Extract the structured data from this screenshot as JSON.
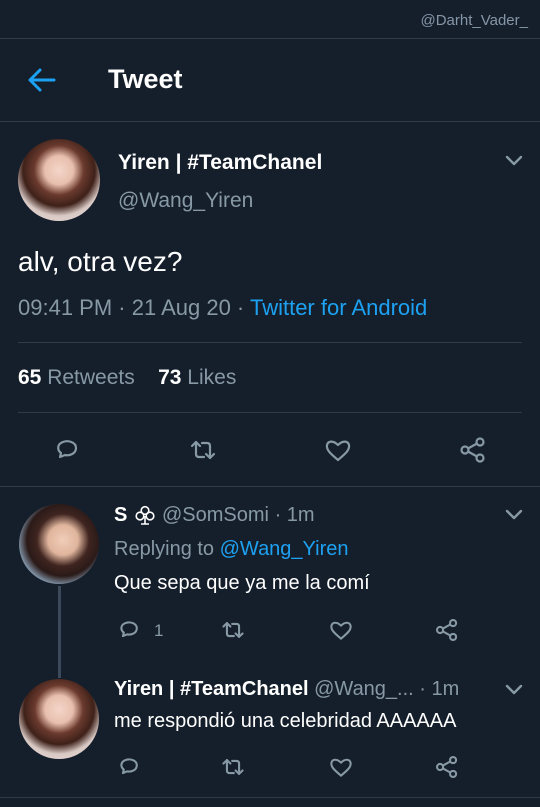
{
  "watermark": "@Darht_Vader_",
  "header": {
    "title": "Tweet"
  },
  "tweet": {
    "name": "Yiren | #TeamChanel",
    "handle": "@Wang_Yiren",
    "text": "alv, otra vez?",
    "time": "09:41 PM · 21 Aug 20 · ",
    "source": "Twitter for Android",
    "retweets_count": "65",
    "retweets_label": "Retweets",
    "likes_count": "73",
    "likes_label": "Likes"
  },
  "reply1": {
    "name": "S",
    "handle": "@SomSomi",
    "time": "· 1m",
    "replying_prefix": "Replying to ",
    "replying_to": "@Wang_Yiren",
    "text": "Que sepa que ya me la comí",
    "reply_count": "1"
  },
  "reply2": {
    "name": "Yiren | #TeamChanel",
    "handle": "@Wang_...",
    "time": "· 1m",
    "text": "me respondió una celebridad AAAAAA"
  },
  "colors": {
    "background": "#151f2b",
    "accent": "#1da1f2",
    "secondary": "#8899a6"
  },
  "icons": [
    "back-arrow-icon",
    "chevron-down-icon",
    "reply-icon",
    "retweet-icon",
    "like-icon",
    "share-icon",
    "club-icon"
  ]
}
